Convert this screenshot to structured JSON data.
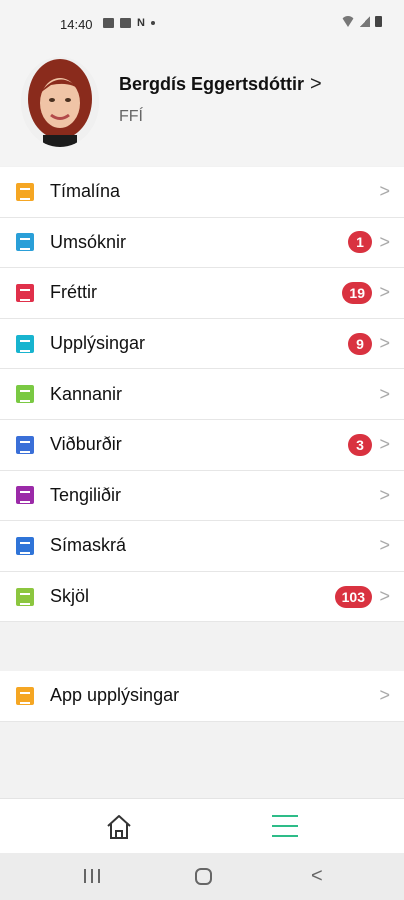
{
  "status_bar": {
    "time": "14:40",
    "n_icon": "N"
  },
  "profile": {
    "name": "Bergdís Eggertsdóttir",
    "chevron": ">",
    "org": "FFÍ"
  },
  "menu": [
    {
      "label": "Tímalína",
      "icon": "timeline-icon",
      "color": "#f5a623",
      "badge": null
    },
    {
      "label": "Umsóknir",
      "icon": "application-icon",
      "color": "#2a9fd8",
      "badge": "1"
    },
    {
      "label": "Fréttir",
      "icon": "news-icon",
      "color": "#e0304a",
      "badge": "19"
    },
    {
      "label": "Upplýsingar",
      "icon": "info-icon",
      "color": "#18b4cf",
      "badge": "9"
    },
    {
      "label": "Kannanir",
      "icon": "survey-icon",
      "color": "#7ac943",
      "badge": null
    },
    {
      "label": "Viðburðir",
      "icon": "calendar-icon",
      "color": "#3a6fd8",
      "badge": "3"
    },
    {
      "label": "Tengiliðir",
      "icon": "contacts-icon",
      "color": "#9b2aa8",
      "badge": null
    },
    {
      "label": "Símaskrá",
      "icon": "phonebook-icon",
      "color": "#2f74d8",
      "badge": null
    },
    {
      "label": "Skjöl",
      "icon": "documents-icon",
      "color": "#8cc63f",
      "badge": "103"
    }
  ],
  "app_info": {
    "label": "App upplýsingar",
    "icon": "gear-icon",
    "color": "#f5a623"
  },
  "row_chevron": ">",
  "tabbar": {
    "active_color": "#2ebc88"
  },
  "navbar": {
    "back": "<"
  }
}
